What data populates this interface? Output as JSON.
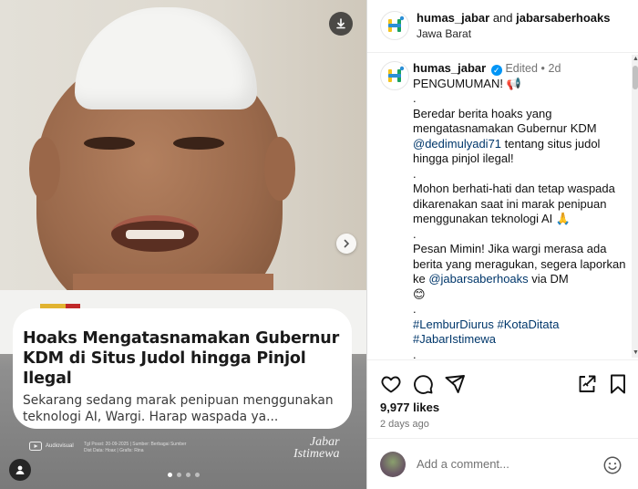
{
  "post": {
    "card_title": "Hoaks Mengatasnamakan Gubernur KDM di Situs Judol hingga Pinjol Ilegal",
    "card_subtitle": "Sekarang sedang marak penipuan menggunakan teknologi AI, Wargi. Harap waspada ya...",
    "footer_brand": "Audiovisual",
    "footer_info": "Tgl Posst: 20-09-2025 | Sumber: Berbagai Sumber\nDist Data: Hoax | Grafis: Rina",
    "jabar_logo_line1": "Jabar",
    "jabar_logo_line2": "Istimewa",
    "slides_total": 4,
    "slide_active": 1
  },
  "header": {
    "account1": "humas_jabar",
    "connector": " and ",
    "account2": "jabarsaberhoaks",
    "location": "Jawa Barat"
  },
  "caption": {
    "username": "humas_jabar",
    "edited": "Edited",
    "separator": "•",
    "time": "2d",
    "lines": {
      "l1": "PENGUMUMAN! 📢",
      "dot": ".",
      "p1a": "Beredar berita hoaks yang mengatasnamakan Gubernur KDM ",
      "p1mention": "@dedimulyadi71",
      "p1b": " tentang situs judol hingga pinjol ilegal!",
      "p2": "Mohon berhati-hati dan tetap waspada dikarenakan saat ini marak penipuan menggunakan teknologi AI 🙏",
      "p3a": "Pesan Mimin! Jika wargi merasa ada berita yang meragukan, segera laporkan ke ",
      "p3mention": "@jabarsaberhoaks",
      "p3b": " via DM",
      "emoji": "😊",
      "hashtags1": "#LemburDiurus #KotaDitata",
      "hashtags2": "#JabarIstimewa"
    }
  },
  "stats": {
    "likes": "9,977 likes",
    "ago": "2 days ago"
  },
  "comment": {
    "placeholder": "Add a comment..."
  },
  "colors": {
    "verified": "#0095f6",
    "link": "#00376b",
    "muted": "#737373",
    "logo_yellow": "#f2c21b",
    "logo_green": "#1aa260",
    "logo_blue": "#2b8fd6"
  },
  "icons": [
    "download-icon",
    "chevron-right-icon",
    "user-tag-icon",
    "heart-icon",
    "comment-icon",
    "share-icon",
    "repost-icon",
    "bookmark-icon",
    "emoji-icon"
  ]
}
